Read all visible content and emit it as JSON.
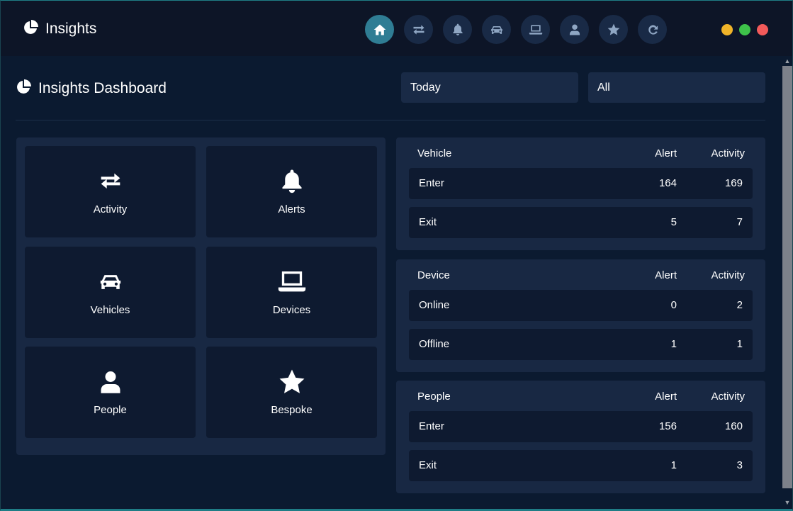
{
  "app": {
    "title": "Insights"
  },
  "nav": {
    "items": [
      {
        "icon": "home-icon",
        "active": true
      },
      {
        "icon": "transfer-icon",
        "active": false
      },
      {
        "icon": "bell-icon",
        "active": false
      },
      {
        "icon": "car-icon",
        "active": false
      },
      {
        "icon": "laptop-icon",
        "active": false
      },
      {
        "icon": "user-icon",
        "active": false
      },
      {
        "icon": "star-icon",
        "active": false
      },
      {
        "icon": "refresh-icon",
        "active": false
      }
    ]
  },
  "window_controls": {
    "colors": [
      "#f0b429",
      "#3ec24a",
      "#f25a5a"
    ]
  },
  "dashboard": {
    "title": "Insights Dashboard",
    "filter_period": "Today",
    "filter_scope": "All"
  },
  "tiles": [
    {
      "label": "Activity",
      "icon": "transfer-icon"
    },
    {
      "label": "Alerts",
      "icon": "bell-icon"
    },
    {
      "label": "Vehicles",
      "icon": "car-icon"
    },
    {
      "label": "Devices",
      "icon": "laptop-icon"
    },
    {
      "label": "People",
      "icon": "user-icon"
    },
    {
      "label": "Bespoke",
      "icon": "star-icon"
    }
  ],
  "stats": [
    {
      "header": "Vehicle",
      "col_alert": "Alert",
      "col_activity": "Activity",
      "rows": [
        {
          "label": "Enter",
          "alert": "164",
          "activity": "169"
        },
        {
          "label": "Exit",
          "alert": "5",
          "activity": "7"
        }
      ]
    },
    {
      "header": "Device",
      "col_alert": "Alert",
      "col_activity": "Activity",
      "rows": [
        {
          "label": "Online",
          "alert": "0",
          "activity": "2"
        },
        {
          "label": "Offline",
          "alert": "1",
          "activity": "1"
        }
      ]
    },
    {
      "header": "People",
      "col_alert": "Alert",
      "col_activity": "Activity",
      "rows": [
        {
          "label": "Enter",
          "alert": "156",
          "activity": "160"
        },
        {
          "label": "Exit",
          "alert": "1",
          "activity": "3"
        }
      ]
    }
  ],
  "colors": {
    "accent": "#2f7d94",
    "background": "#0b1a30",
    "panel": "#182843",
    "tile": "#0e1a30"
  }
}
